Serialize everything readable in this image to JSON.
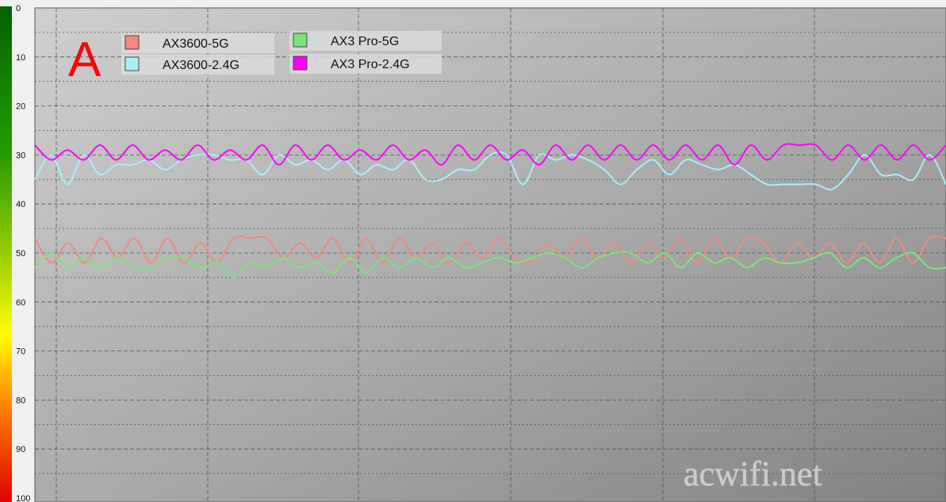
{
  "chart_data": {
    "type": "line",
    "title": "",
    "xlabel": "",
    "ylabel": "",
    "ylim": [
      0,
      100
    ],
    "y_inverted": true,
    "y_ticks": [
      "0",
      "10",
      "20",
      "30",
      "40",
      "50",
      "60",
      "70",
      "80",
      "90",
      "100"
    ],
    "grid": true,
    "legend_position": "top-left",
    "panel_letter": "A",
    "watermark": "acwifi.net",
    "series": [
      {
        "name": "AX3600-5G",
        "color": "#f08a80",
        "values": [
          47,
          52,
          48,
          52,
          47,
          51,
          47,
          52,
          47,
          52,
          48,
          52,
          47,
          47,
          47,
          51,
          48,
          51,
          47,
          52,
          47,
          52,
          47,
          51,
          48,
          52,
          48,
          51,
          47,
          51,
          52,
          48,
          51,
          47,
          51,
          48,
          52,
          48,
          51,
          47,
          52,
          47,
          51,
          47,
          48,
          52,
          48,
          51,
          48,
          52,
          48,
          52,
          47,
          52,
          47,
          47
        ]
      },
      {
        "name": "AX3600-2.4G",
        "color": "#aaeef5",
        "values": [
          35,
          30,
          36,
          30,
          34,
          32,
          32,
          31,
          33,
          31,
          30,
          30,
          31,
          31,
          34,
          30,
          32,
          31,
          33,
          31,
          34,
          32,
          33,
          31,
          35,
          35,
          33,
          33,
          30,
          30,
          36,
          30,
          31,
          30,
          31,
          33,
          36,
          33,
          31,
          34,
          31,
          32,
          33,
          32,
          34,
          36,
          36,
          36,
          36,
          37,
          34,
          30,
          34,
          34,
          35,
          30,
          36
        ]
      },
      {
        "name": "AX3 Pro-5G",
        "color": "#7ce47c",
        "values": [
          53,
          50,
          53,
          51,
          53,
          51,
          53,
          53,
          51,
          51,
          53,
          52,
          55,
          52,
          53,
          51,
          53,
          52,
          54,
          51,
          54,
          51,
          53,
          51,
          53,
          51,
          53,
          52,
          51,
          52,
          51,
          50,
          51,
          53,
          51,
          50,
          50,
          52,
          50,
          53,
          50,
          52,
          51,
          53,
          51,
          52,
          52,
          51,
          50,
          53,
          51,
          53,
          51,
          50,
          53,
          53
        ]
      },
      {
        "name": "AX3 Pro-2.4G",
        "color": "#ff00ff",
        "values": [
          28,
          31,
          29,
          31,
          28,
          31,
          28,
          31,
          29,
          31,
          28,
          31,
          29,
          31,
          28,
          32,
          28,
          31,
          28,
          31,
          29,
          31,
          28,
          31,
          29,
          32,
          28,
          31,
          28,
          31,
          29,
          32,
          28,
          31,
          28,
          31,
          28,
          31,
          28,
          31,
          28,
          31,
          28,
          32,
          28,
          31,
          28,
          28,
          28,
          31,
          28,
          31,
          28,
          31,
          28,
          31,
          28
        ]
      }
    ]
  }
}
